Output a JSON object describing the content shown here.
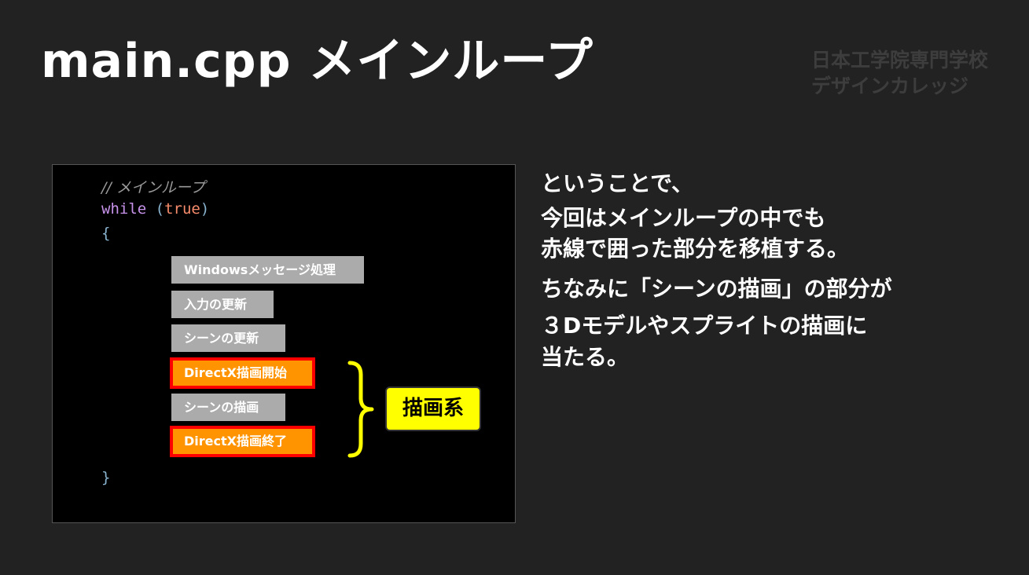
{
  "slide": {
    "title": "main.cpp メインループ",
    "logo": {
      "line1": "日本工学院専門学校",
      "line2": "デザインカレッジ"
    }
  },
  "code": {
    "comment": "// メインループ",
    "keyword_while": "while",
    "paren_open": "(",
    "literal_true": "true",
    "paren_close": ")",
    "brace_open": "{",
    "brace_close": "}"
  },
  "steps": [
    {
      "label": "Windowsメッセージ処理",
      "highlighted": false
    },
    {
      "label": "入力の更新",
      "highlighted": false
    },
    {
      "label": "シーンの更新",
      "highlighted": false
    },
    {
      "label": "DirectX描画開始",
      "highlighted": true
    },
    {
      "label": "シーンの描画",
      "highlighted": false
    },
    {
      "label": "DirectX描画終了",
      "highlighted": true
    }
  ],
  "group_label": "描画系",
  "explanation": {
    "line1": "ということで、",
    "line2": "今回はメインループの中でも",
    "line3": "赤線で囲った部分を移植する。",
    "line4": "ちなみに「シーンの描画」の部分が",
    "line5": "３Dモデルやスプライトの描画に",
    "line6": "当たる。"
  },
  "colors": {
    "background": "#222222",
    "step_gray": "#ababab",
    "step_orange": "#ff9400",
    "highlight_border": "#ff0000",
    "bracket": "#ffff00",
    "label_bg": "#ffff00"
  }
}
